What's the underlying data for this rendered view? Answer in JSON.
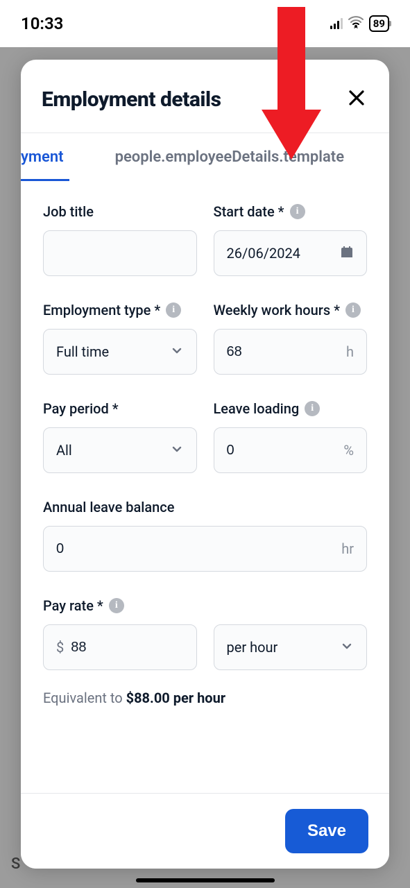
{
  "status_bar": {
    "time": "10:33",
    "battery_pct": "89"
  },
  "modal": {
    "title": "Employment details",
    "tabs": {
      "active_fragment": "yment",
      "second": "people.employeeDetails.template"
    },
    "fields": {
      "job_title": {
        "label": "Job title",
        "value": ""
      },
      "start_date": {
        "label": "Start date *",
        "value": "26/06/2024"
      },
      "employment_type": {
        "label": "Employment type *",
        "value": "Full time"
      },
      "weekly_hours": {
        "label": "Weekly work hours *",
        "value": "68",
        "unit": "h"
      },
      "pay_period": {
        "label": "Pay period *",
        "value": "All"
      },
      "leave_loading": {
        "label": "Leave loading",
        "value": "0",
        "unit": "%"
      },
      "annual_leave_balance": {
        "label": "Annual leave balance",
        "value": "0",
        "unit": "hr"
      },
      "pay_rate": {
        "label": "Pay rate *",
        "currency": "$",
        "value": "88",
        "period": "per hour"
      }
    },
    "equivalent": {
      "prefix": "Equivalent to ",
      "amount": "$88.00 per hour"
    },
    "save_label": "Save"
  }
}
